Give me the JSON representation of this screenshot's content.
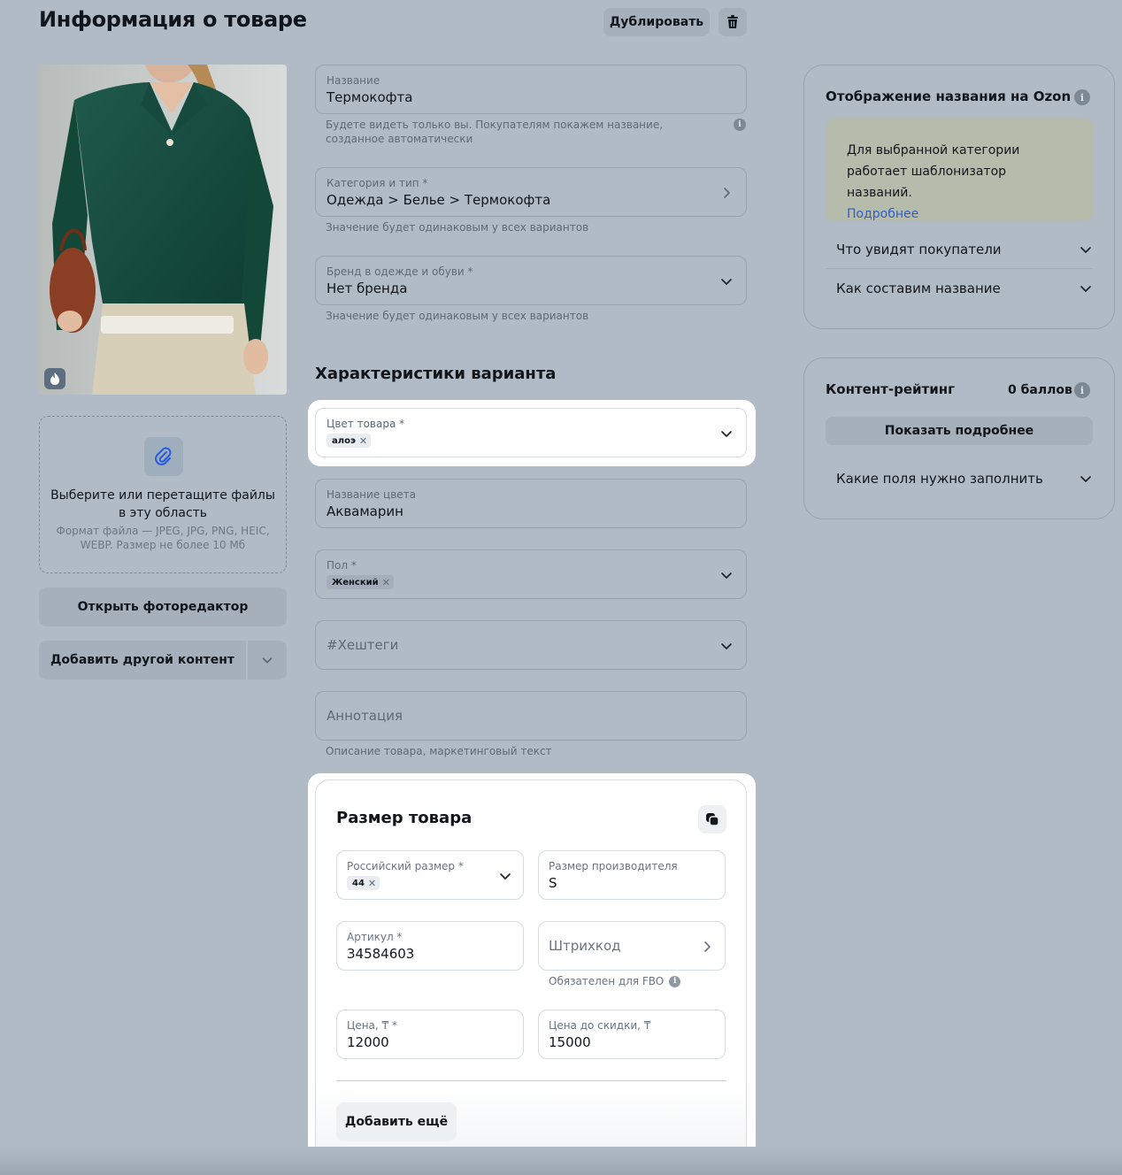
{
  "header": {
    "title": "Информация о товаре",
    "duplicate_label": "Дублировать"
  },
  "left": {
    "upload_main": "Выберите или перетащите файлы в эту область",
    "upload_hint": "Формат файла — JPEG, JPG, PNG, HEIC, WEBP. Размер не более 10 Мб",
    "photo_editor_label": "Открыть фоторедактор",
    "add_content_label": "Добавить другой контент"
  },
  "form": {
    "name": {
      "label": "Название",
      "value": "Термокофта",
      "hint": "Будете видеть только вы. Покупателям покажем название, созданное автоматически"
    },
    "category": {
      "label": "Категория и тип *",
      "value": "Одежда > Белье > Термокофта",
      "hint": "Значение будет одинаковым у всех вариантов"
    },
    "brand": {
      "label": "Бренд в одежде и обуви *",
      "value": "Нет бренда",
      "hint": "Значение будет одинаковым у всех вариантов"
    },
    "variant_section_title": "Характеристики варианта",
    "color": {
      "label": "Цвет товара *",
      "tag": "алоэ"
    },
    "color_name": {
      "label": "Название цвета",
      "value": "Аквамарин"
    },
    "gender": {
      "label": "Пол *",
      "tag": "Женский"
    },
    "hashtags": {
      "placeholder": "#Хештеги"
    },
    "annotation": {
      "placeholder": "Аннотация",
      "hint": "Описание товара, маркетинговый текст"
    }
  },
  "size_card": {
    "title": "Размер товара",
    "ru_size": {
      "label": "Российский размер *",
      "tag": "44"
    },
    "maker_size": {
      "label": "Размер производителя",
      "value": "S"
    },
    "article": {
      "label": "Артикул *",
      "value": "34584603"
    },
    "barcode": {
      "placeholder": "Штрихкод",
      "hint": "Обязателен для FBO"
    },
    "price": {
      "label": "Цена, ₸ *",
      "value": "12000"
    },
    "old_price": {
      "label": "Цена до скидки, ₸",
      "value": "15000"
    },
    "add_more_label": "Добавить ещё"
  },
  "right": {
    "ozon_card": {
      "title": "Отображение названия на Ozon",
      "notice_text": "Для выбранной категории работает шаблонизатор названий.",
      "notice_link": "Подробнее",
      "accordion_1": "Что увидят покупатели",
      "accordion_2": "Как составим название"
    },
    "rating_card": {
      "title": "Контент-рейтинг",
      "score": "0 баллов",
      "details_label": "Показать подробнее",
      "accordion": "Какие поля нужно заполнить"
    }
  },
  "colors": {
    "page_bg": "#b1bbc5",
    "button_bg": "#a5b0bb",
    "highlight": "#ffffff",
    "link": "#2f5dcf",
    "notice_bg": "#b6bcab"
  }
}
